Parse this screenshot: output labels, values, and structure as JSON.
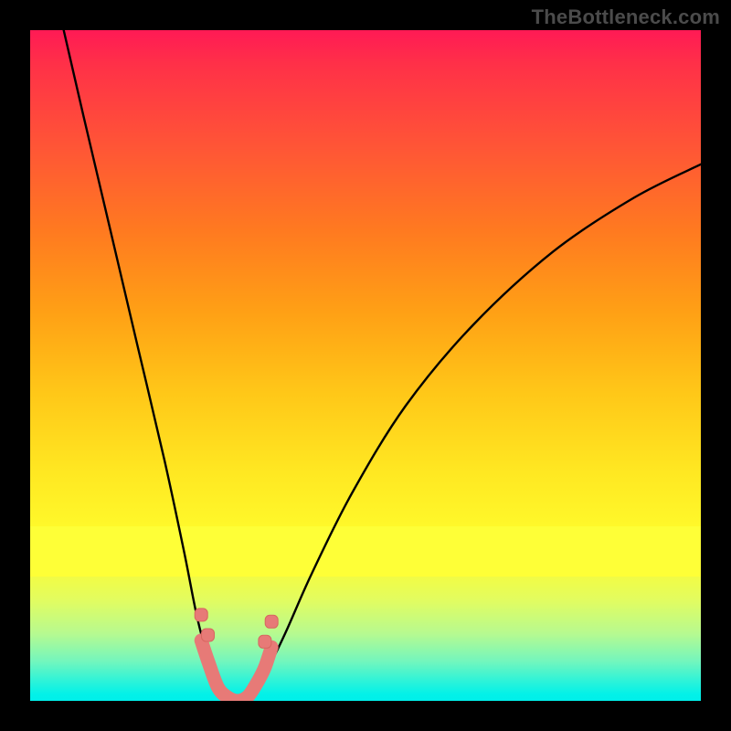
{
  "watermark": "TheBottleneck.com",
  "colors": {
    "background": "#000000",
    "gradient_top": "#ff1a55",
    "gradient_bottom": "#00f0ea",
    "curve": "#000000",
    "marker_fill": "#e77a77",
    "marker_stroke": "#d86660"
  },
  "chart_data": {
    "type": "line",
    "title": "",
    "xlabel": "",
    "ylabel": "",
    "xlim": [
      0,
      100
    ],
    "ylim": [
      0,
      100
    ],
    "note": "bottleneck-style V curve; y is roughly percent bottleneck, x is hardware balance. No numeric axis labels visible.",
    "series": [
      {
        "name": "bottleneck-curve",
        "x": [
          5,
          8,
          12,
          16,
          20,
          23,
          25,
          27,
          29,
          31,
          33,
          35,
          38,
          42,
          48,
          56,
          66,
          78,
          90,
          100
        ],
        "y": [
          100,
          87,
          70,
          53,
          36,
          22,
          12,
          5,
          1,
          0,
          1,
          4,
          10,
          19,
          31,
          44,
          56,
          67,
          75,
          80
        ]
      }
    ],
    "markers": {
      "name": "highlighted-range",
      "x": [
        25.5,
        26.5,
        28,
        29.5,
        31,
        32.5,
        34,
        35,
        36
      ],
      "y": [
        9,
        6,
        2,
        0.5,
        0,
        0.7,
        3,
        5,
        8
      ]
    }
  }
}
